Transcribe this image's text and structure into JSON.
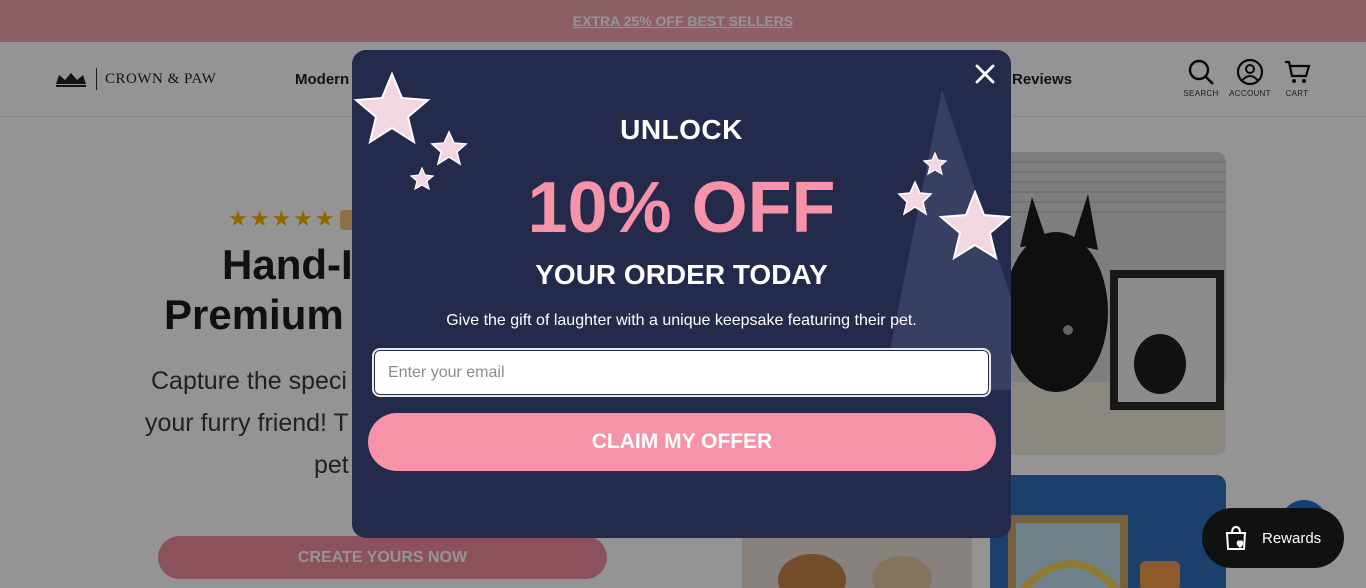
{
  "announcement": {
    "text": "EXTRA 25% OFF BEST SELLERS"
  },
  "header": {
    "logo_text": "CROWN & PAW",
    "nav": {
      "modern": "Modern",
      "reviews": "Reviews"
    },
    "icons": {
      "search": "SEARCH",
      "account": "ACCOUNT",
      "cart": "CART"
    }
  },
  "hero": {
    "rating_icon": "five-star-rating",
    "title_line1": "Hand-I",
    "title_line2": "Premium",
    "subtitle_line1": "Capture the speci",
    "subtitle_line2": "your furry friend! T",
    "subtitle_line3": "pet",
    "cta": "CREATE YOURS NOW"
  },
  "popup": {
    "headline_top": "UNLOCK",
    "headline_main": "10% OFF",
    "headline_bottom": "YOUR ORDER TODAY",
    "description": "Give the gift of laughter with a unique keepsake featuring their pet.",
    "email_placeholder": "Enter your email",
    "email_value": "",
    "claim_label": "CLAIM MY OFFER",
    "close_icon": "close-icon"
  },
  "rewards": {
    "label": "Rewards"
  },
  "colors": {
    "accent_pink": "#f793a8",
    "popup_bg": "#242a4b",
    "announce_bg": "#f3a6b2"
  }
}
